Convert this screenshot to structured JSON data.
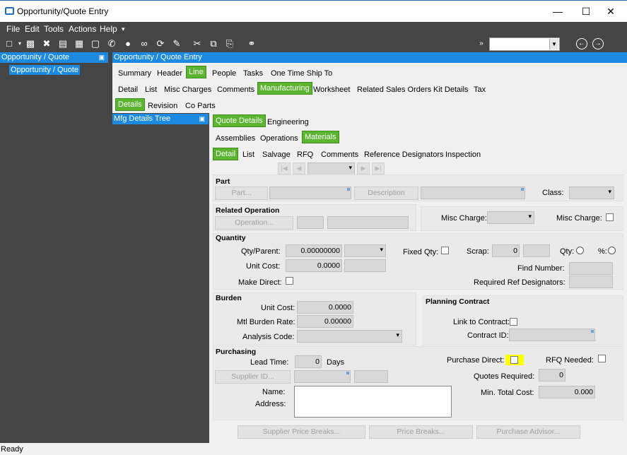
{
  "window": {
    "title": "Opportunity/Quote Entry",
    "controls": [
      "minimize-icon",
      "maximize-icon",
      "close-icon"
    ]
  },
  "menu": [
    "File",
    "Edit",
    "Tools",
    "Actions",
    "Help"
  ],
  "toolbar": {
    "icons": [
      "new-icon",
      "save-icon",
      "delete-icon",
      "book-icon",
      "grid-icon",
      "note-icon",
      "phone-icon",
      "chat-icon",
      "attach-icon",
      "refresh-icon",
      "clear-icon",
      "cut-icon",
      "copy-icon",
      "paste-icon",
      "binoculars-icon"
    ],
    "combo_value": ""
  },
  "left_panel": {
    "header": "Opportunity / Quote",
    "tree_node": "Opportunity / Quote"
  },
  "main_panel": {
    "header": "Opportunity / Quote Entry",
    "tabs_row1": [
      "Summary",
      "Header",
      "Line",
      "People",
      "Tasks",
      "One Time Ship To"
    ],
    "tabs_row2": [
      "Detail",
      "List",
      "Misc Charges",
      "Comments",
      "Manufacturing",
      "Worksheet",
      "Related Sales Orders",
      "Kit Details",
      "Tax"
    ],
    "tabs_row3": [
      "Details",
      "Revision",
      "Co Parts"
    ]
  },
  "mfg_tree": {
    "header": "Mfg Details Tree"
  },
  "subtabs": {
    "row1": [
      "Quote Details",
      "Engineering"
    ],
    "row2": [
      "Assemblies",
      "Operations",
      "Materials"
    ],
    "row3": [
      "Detail",
      "List",
      "Salvage",
      "RFQ",
      "Comments",
      "Reference Designators",
      "Inspection"
    ]
  },
  "part": {
    "title": "Part",
    "part_button": "Part...",
    "description_button": "Description",
    "class_label": "Class:"
  },
  "related_operation": {
    "title": "Related Operation",
    "operation_button": "Operation...",
    "misc_charge_label1": "Misc Charge:",
    "misc_charge_label2": "Misc Charge:"
  },
  "quantity": {
    "title": "Quantity",
    "qty_parent_label": "Qty/Parent:",
    "qty_parent_value": "0.00000000",
    "fixed_qty_label": "Fixed Qty:",
    "scrap_label": "Scrap:",
    "scrap_value": "0",
    "qty_label": "Qty:",
    "pct_label": "%:",
    "unit_cost_label": "Unit Cost:",
    "unit_cost_value": "0.0000",
    "find_number_label": "Find Number:",
    "make_direct_label": "Make Direct:",
    "required_ref_label": "Required Ref Designators:"
  },
  "burden": {
    "title": "Burden",
    "unit_cost_label": "Unit Cost:",
    "unit_cost_value": "0.0000",
    "mtl_burden_label": "Mtl  Burden Rate:",
    "mtl_burden_value": "0.00000",
    "analysis_code_label": "Analysis Code:"
  },
  "planning_contract": {
    "title": "Planning Contract",
    "link_label": "Link to Contract:",
    "contract_id_label": "Contract ID:"
  },
  "purchasing": {
    "title": "Purchasing",
    "lead_time_label": "Lead Time:",
    "lead_time_value": "0",
    "days_label": "Days",
    "supplier_button": "Supplier ID...",
    "name_label": "Name:",
    "address_label": "Address:",
    "purchase_direct_label": "Purchase Direct:",
    "rfq_needed_label": "RFQ Needed:",
    "quotes_required_label": "Quotes Required:",
    "quotes_required_value": "0",
    "min_total_cost_label": "Min. Total Cost:",
    "min_total_cost_value": "0.000"
  },
  "bottom_buttons": [
    "Supplier Price Breaks...",
    "Price Breaks...",
    "Purchase Advisor..."
  ],
  "status": "Ready",
  "colors": {
    "accent": "#1c8ae0",
    "active_tab": "#5cb531",
    "highlight": "#ffff00",
    "dark_bg": "#454545"
  }
}
